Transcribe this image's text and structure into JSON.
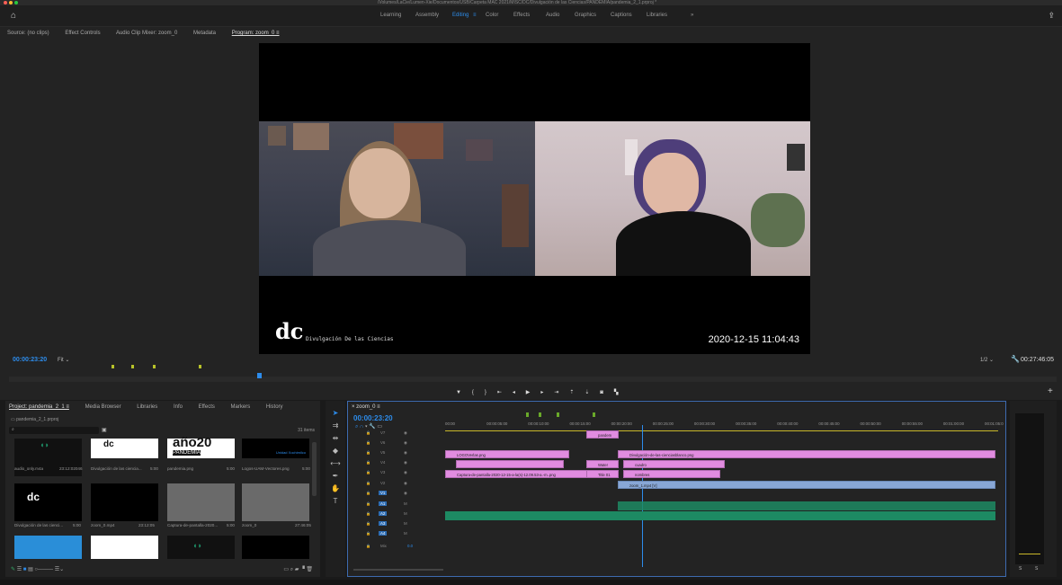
{
  "window": {
    "title_path": "/Volumes/LaCie/Lumen-Xie/Documentos/USB/Carpeta MAC 2021/MISC/DC/Divulgación de las Ciencias/PANDEMIA/pandemia_2_1.prproj *"
  },
  "workspaces": [
    "Learning",
    "Assembly",
    "Editing",
    "Color",
    "Effects",
    "Audio",
    "Graphics",
    "Captions",
    "Libraries",
    "»"
  ],
  "active_workspace": "Editing",
  "source_tabs": [
    "Source: (no clips)",
    "Effect Controls",
    "Audio Clip Mixer: zoom_0",
    "Metadata",
    "Program: zoom_0  ≡"
  ],
  "program": {
    "overlay_logo": "dc",
    "overlay_text": "Divulgación De las Ciencias",
    "datetime": "2020-12-15  11:04:43",
    "timecode": "00:00:23:20",
    "fit": "Fit",
    "zoom": "1/2",
    "duration": "00:27:46:05"
  },
  "project": {
    "tabs": [
      "Project: pandemia_2_1  ≡",
      "Media Browser",
      "Libraries",
      "Info",
      "Effects",
      "Markers",
      "History"
    ],
    "file": "pandemia_2_1.prproj",
    "items_count": "31 items",
    "search_placeholder": "",
    "items": [
      {
        "name": "audio_only.m4a",
        "meta": "23:12:02046"
      },
      {
        "name": "Divulgación de las ciencia...",
        "meta": "5:00"
      },
      {
        "name": "pandemia.png",
        "meta": "5:00"
      },
      {
        "name": "Logos-UAM-Vectores.png",
        "meta": "5:00"
      },
      {
        "name": "Divulgación de las cienci...",
        "meta": "5:00"
      },
      {
        "name": "zoom_0.mp4",
        "meta": "23:12:05"
      },
      {
        "name": "Captura-de-pantalla-2020...",
        "meta": "5:00"
      },
      {
        "name": "zoom_0",
        "meta": "27:46:05"
      }
    ],
    "thumb_texts": [
      "año20",
      "PANDEMIA",
      "Unidad Xochimilco"
    ]
  },
  "timeline": {
    "tab": "zoom_0  ≡",
    "timecode": "00:00:23:20",
    "ruler": [
      "00:00",
      "00:00:05:00",
      "00:00:10:00",
      "00:00:15:00",
      "00:00:20:00",
      "00:00:25:00",
      "00:00:30:00",
      "00:00:35:00",
      "00:00:40:00",
      "00:00:45:00",
      "00:00:50:00",
      "00:00:55:00",
      "00:01:00:00",
      "00:01:05:0"
    ],
    "tracks": [
      "V7",
      "V6",
      "V5",
      "V4",
      "V3",
      "V2",
      "V1",
      "A1",
      "A2",
      "A3",
      "A4",
      "Mix"
    ],
    "mix_value": "0.0",
    "clips": {
      "logo": "LOGOVerlas.png",
      "divulg": "Divulgación-de-las-cienciasblanco.png",
      "captura": "Captura-de-pantalla-2020-12-15-a-la(s)-12.09.53-a.-m..png",
      "title01": "Title 01",
      "water": "Water",
      "cuadro": "cuadro",
      "nombres": "nombres",
      "zoom": "zoom_1.mp4 [V]",
      "pandemia": "pandem"
    }
  },
  "meter": {
    "labels": [
      "S",
      "S"
    ]
  },
  "colors": {
    "accent": "#2d8ceb",
    "clip_pink": "#e18ce0",
    "clip_blue": "#88a7d6",
    "audio_green": "#1d8a63"
  }
}
